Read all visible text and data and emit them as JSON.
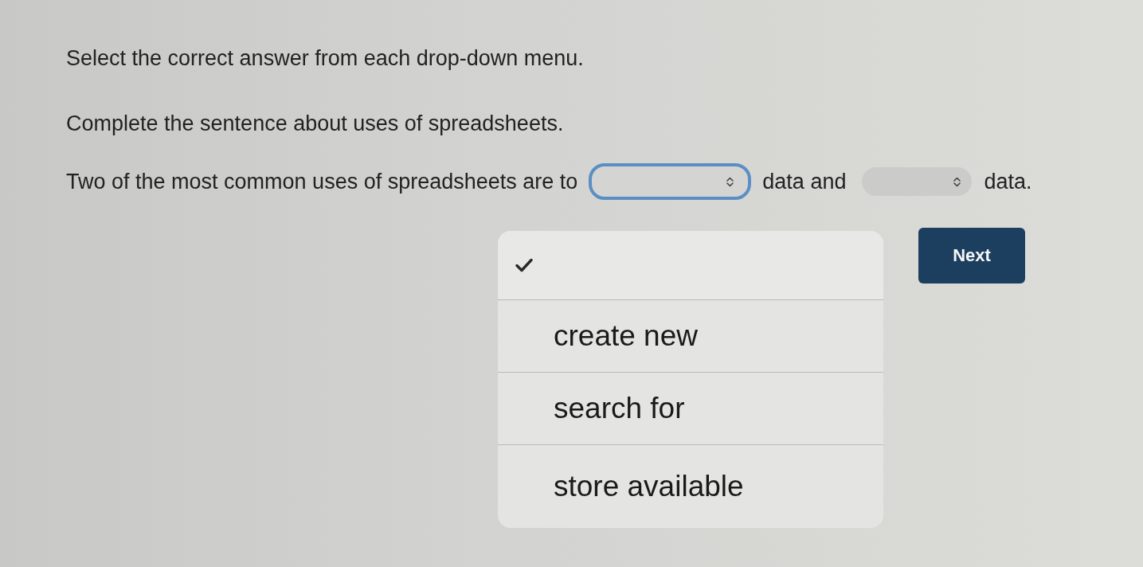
{
  "instructions": [
    "Select the correct answer from each drop-down menu.",
    "Complete the sentence about uses of spreadsheets."
  ],
  "sentence": [
    {
      "kind": "text",
      "text": "Two of the most common uses of spreadsheets are to"
    },
    {
      "kind": "dropdown",
      "focused": true
    },
    {
      "kind": "text",
      "text": "data and"
    },
    {
      "kind": "dropdown",
      "focused": false
    },
    {
      "kind": "text",
      "text": "data."
    }
  ],
  "menu": {
    "options": [
      {
        "selected": true
      },
      {
        "label": "create new",
        "selected": false
      },
      {
        "label": "search for",
        "selected": false
      },
      {
        "label": "store available",
        "selected": false
      }
    ]
  },
  "next_button": {
    "label": "Next"
  }
}
